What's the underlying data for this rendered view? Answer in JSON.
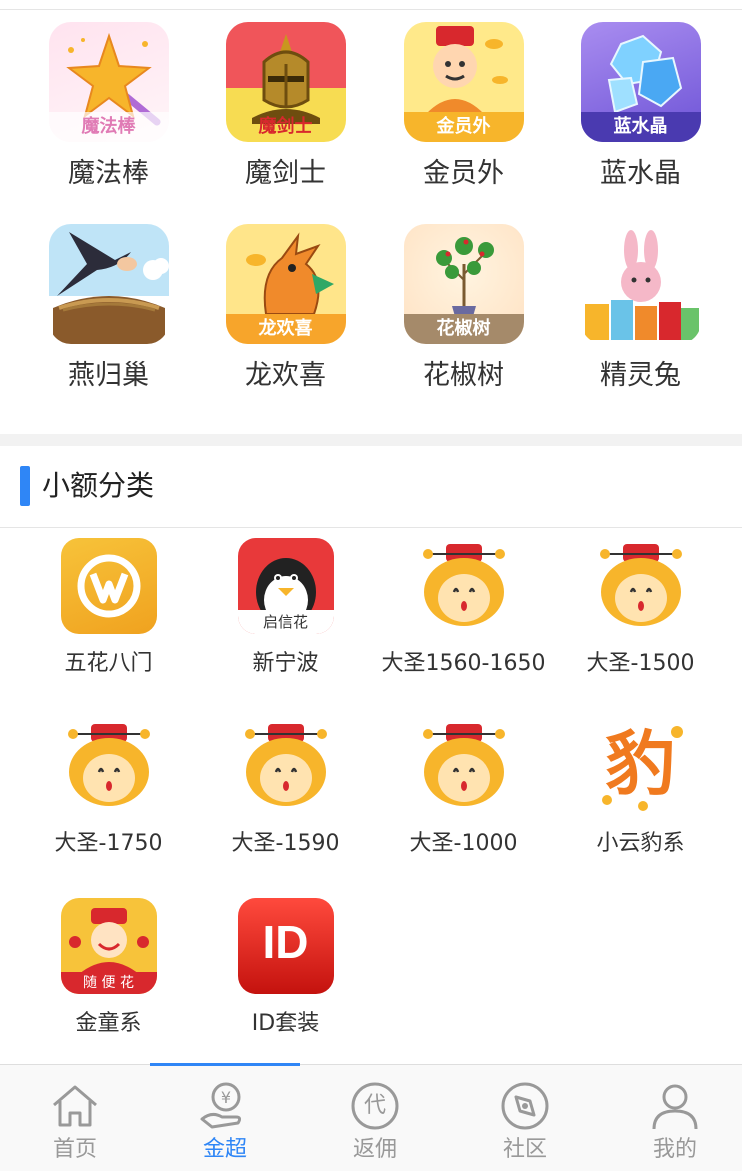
{
  "top_grid": [
    {
      "label": "魔法棒",
      "badge": "魔法棒",
      "icon": "magic-wand-icon"
    },
    {
      "label": "魔剑士",
      "badge": "魔剑士",
      "icon": "knight-helmet-icon"
    },
    {
      "label": "金员外",
      "badge": "金员外",
      "icon": "rich-man-icon"
    },
    {
      "label": "蓝水晶",
      "badge": "蓝水晶",
      "icon": "blue-crystal-icon"
    },
    {
      "label": "燕归巢",
      "badge": "",
      "icon": "swallow-nest-icon"
    },
    {
      "label": "龙欢喜",
      "badge": "龙欢喜",
      "icon": "dragon-icon"
    },
    {
      "label": "花椒树",
      "badge": "花椒树",
      "icon": "pepper-tree-icon"
    },
    {
      "label": "精灵兔",
      "badge": "",
      "icon": "rabbit-gift-icon"
    }
  ],
  "section": {
    "title": "小额分类"
  },
  "small_grid": [
    {
      "label": "五花八门",
      "icon": "wuhua-logo-icon"
    },
    {
      "label": "新宁波",
      "icon": "penguin-icon",
      "badge": "启信花"
    },
    {
      "label": "大圣1560-1650",
      "icon": "monkey-king-icon"
    },
    {
      "label": "大圣-1500",
      "icon": "monkey-king-icon"
    },
    {
      "label": "大圣-1750",
      "icon": "monkey-king-icon"
    },
    {
      "label": "大圣-1590",
      "icon": "monkey-king-icon"
    },
    {
      "label": "大圣-1000",
      "icon": "monkey-king-icon"
    },
    {
      "label": "小云豹系",
      "icon": "leopard-char-icon",
      "glyph": "豹"
    },
    {
      "label": "金童系",
      "icon": "god-of-wealth-icon",
      "badge": "随 便 花"
    },
    {
      "label": "ID套装",
      "icon": "id-logo-icon",
      "glyph": "ID"
    }
  ],
  "tabs": [
    {
      "label": "首页",
      "icon": "home-icon"
    },
    {
      "label": "金超",
      "icon": "money-hand-icon",
      "active": true
    },
    {
      "label": "返佣",
      "icon": "commission-icon",
      "glyph": "代"
    },
    {
      "label": "社区",
      "icon": "compass-icon"
    },
    {
      "label": "我的",
      "icon": "user-icon"
    }
  ],
  "colors": {
    "accent": "#2f86f6",
    "text": "#333333",
    "tab_inactive": "#999999"
  }
}
